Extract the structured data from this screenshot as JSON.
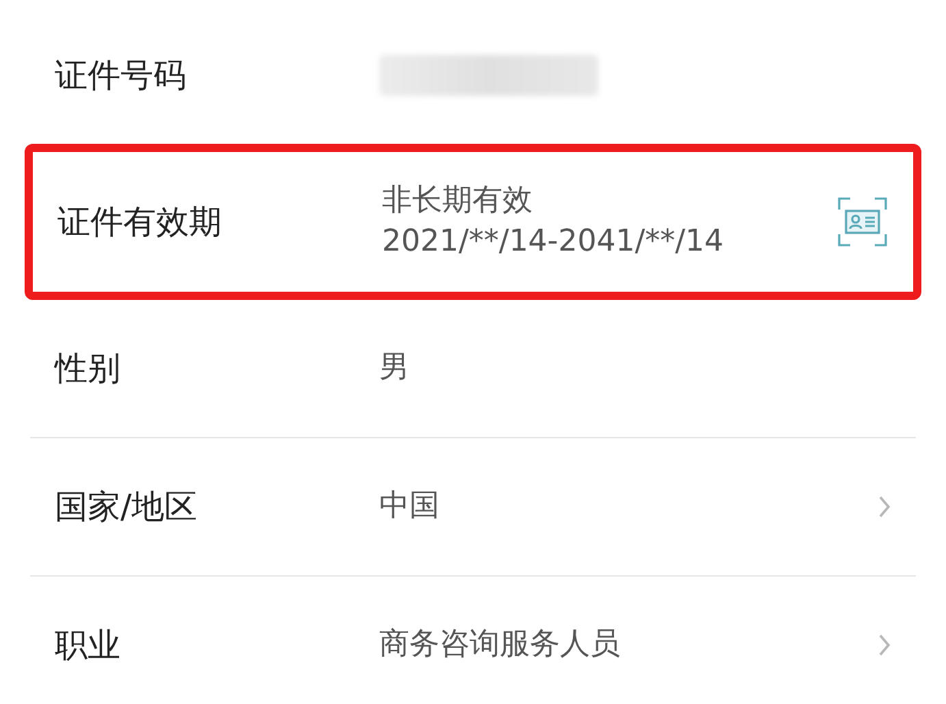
{
  "rows": [
    {
      "label": "证件号码",
      "kind": "redacted",
      "highlighted": false,
      "chevron": false
    },
    {
      "label": "证件有效期",
      "kind": "scan",
      "lines": [
        "非长期有效",
        "2021/**/14-2041/**/14"
      ],
      "highlighted": true,
      "chevron": false
    },
    {
      "label": "性别",
      "kind": "text",
      "lines": [
        "男"
      ],
      "highlighted": false,
      "chevron": false
    },
    {
      "label": "国家/地区",
      "kind": "text",
      "lines": [
        "中国"
      ],
      "highlighted": false,
      "chevron": true
    },
    {
      "label": "职业",
      "kind": "text",
      "lines": [
        "商务咨询服务人员"
      ],
      "highlighted": false,
      "chevron": true
    }
  ]
}
